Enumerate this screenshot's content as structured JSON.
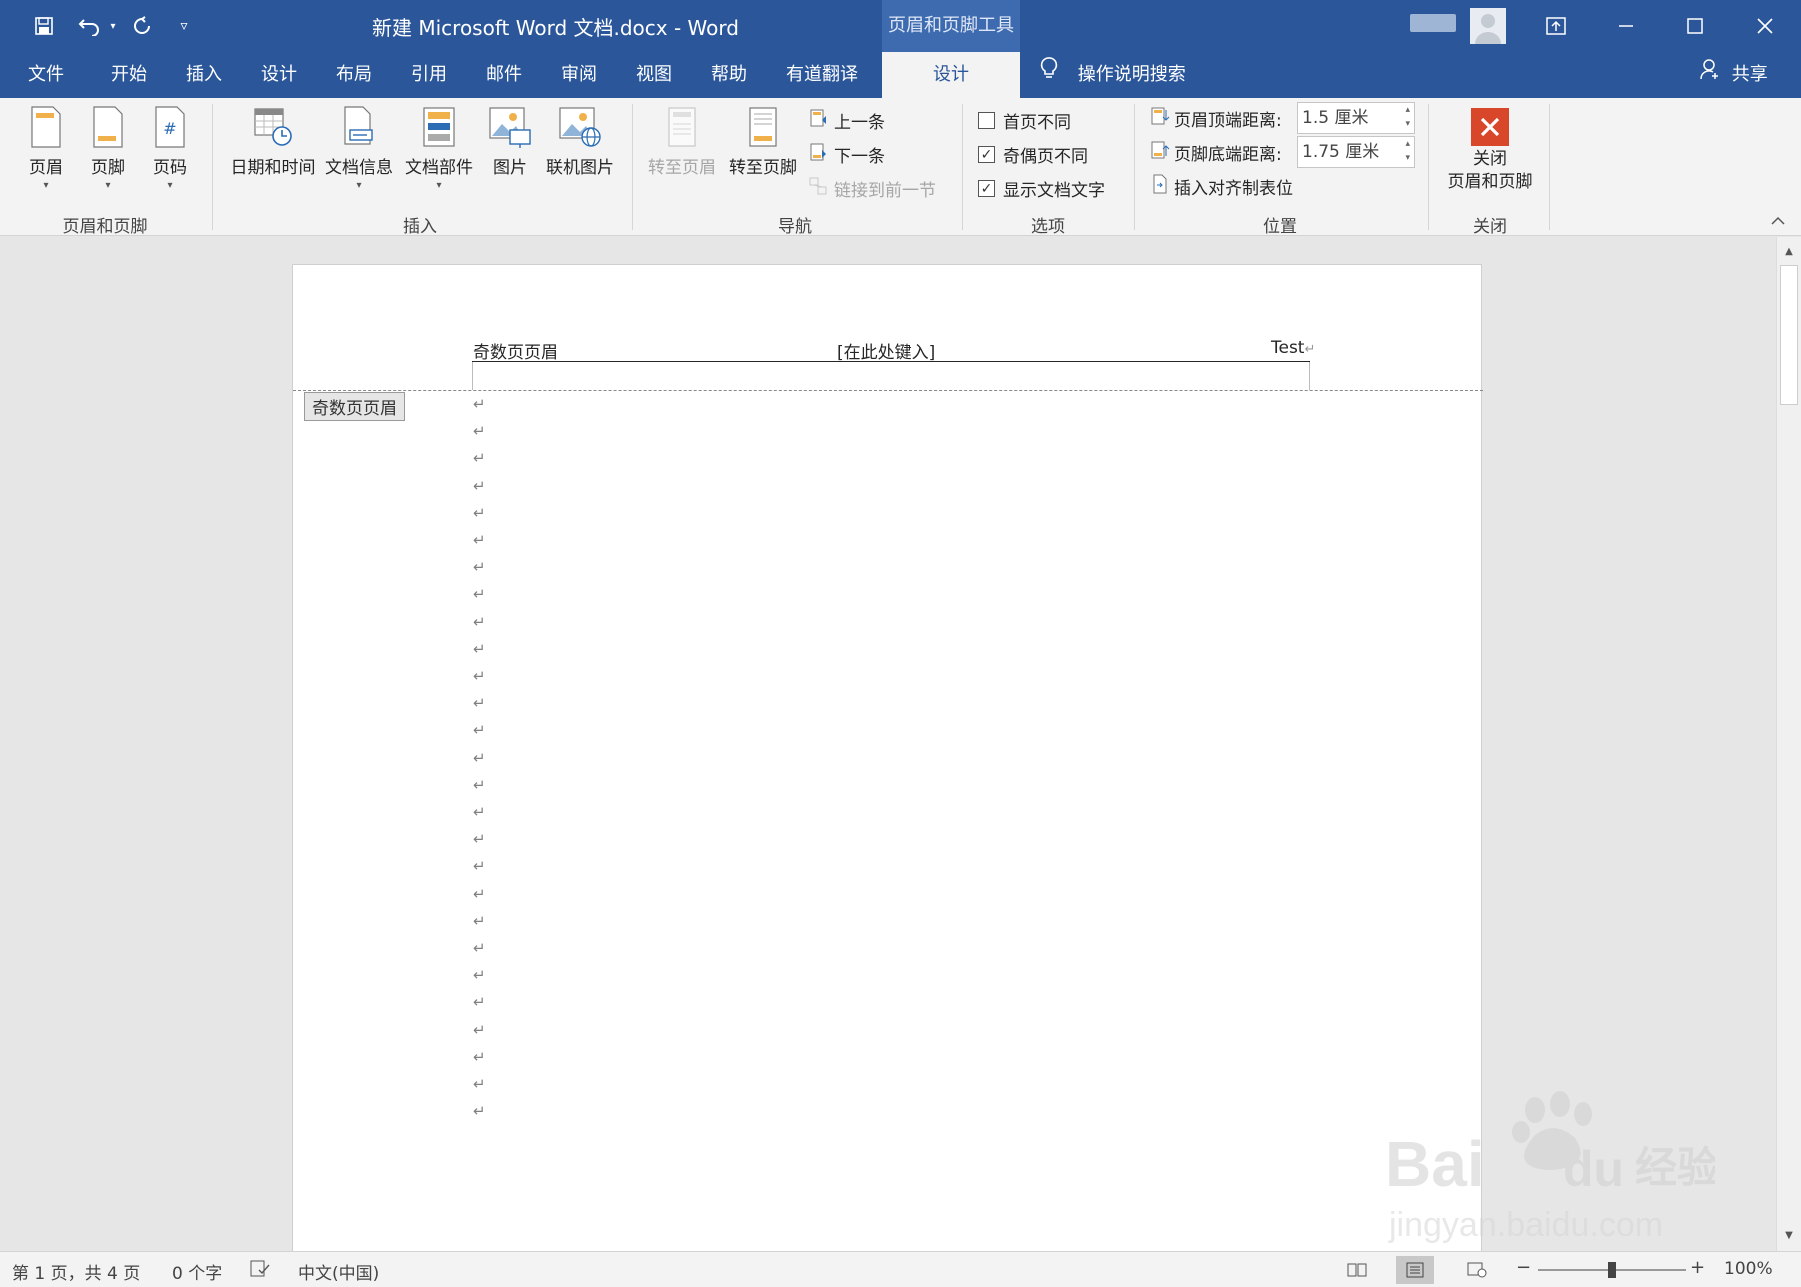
{
  "titlebar": {
    "title": "新建 Microsoft Word 文档.docx  -  Word",
    "context_tab": "页眉和页脚工具",
    "icons": [
      "save-icon",
      "undo-icon",
      "redo-icon",
      "customize-qat-icon"
    ],
    "window_controls": [
      "ribbon-display-icon",
      "minimize-icon",
      "maximize-icon",
      "close-icon"
    ]
  },
  "tabs": {
    "items": [
      "文件",
      "开始",
      "插入",
      "设计",
      "布局",
      "引用",
      "邮件",
      "审阅",
      "视图",
      "帮助",
      "有道翻译",
      "设计"
    ],
    "active_index": 11,
    "tellme": "操作说明搜索",
    "share": "共享"
  },
  "ribbon": {
    "group_header_footer": {
      "label": "页眉和页脚",
      "header": "页眉",
      "footer": "页脚",
      "page_number": "页码"
    },
    "group_insert": {
      "label": "插入",
      "date_time": "日期和时间",
      "doc_info": "文档信息",
      "doc_parts": "文档部件",
      "picture": "图片",
      "online_picture": "联机图片"
    },
    "group_navigation": {
      "label": "导航",
      "goto_header": "转至页眉",
      "goto_footer": "转至页脚",
      "previous": "上一条",
      "next": "下一条",
      "link_previous": "链接到前一节"
    },
    "group_options": {
      "label": "选项",
      "different_first": "首页不同",
      "different_odd_even": "奇偶页不同",
      "show_doc_text": "显示文档文字",
      "different_first_checked": false,
      "different_odd_even_checked": true,
      "show_doc_text_checked": true
    },
    "group_position": {
      "label": "位置",
      "header_top_label": "页眉顶端距离:",
      "header_top_value": "1.5 厘米",
      "footer_bottom_label": "页脚底端距离:",
      "footer_bottom_value": "1.75 厘米",
      "insert_align_tab": "插入对齐制表位"
    },
    "group_close": {
      "label": "关闭",
      "close_line1": "关闭",
      "close_line2": "页眉和页脚"
    }
  },
  "document": {
    "header_left": "奇数页页眉",
    "header_center": "[在此处键入]",
    "header_right": "Test",
    "header_mark": "↵",
    "header_tag": "奇数页页眉",
    "paragraph_mark": "↵",
    "paragraph_count": 27
  },
  "statusbar": {
    "page": "第 1 页，共 4 页",
    "words": "0 个字",
    "language": "中文(中国)",
    "zoom": "100%",
    "zoom_minus": "−",
    "zoom_plus": "+"
  },
  "colors": {
    "accent": "#2b579a",
    "ribbon_bg": "#f3f3f3",
    "doc_bg": "#e6e6e6",
    "close_red": "#d9472b"
  }
}
